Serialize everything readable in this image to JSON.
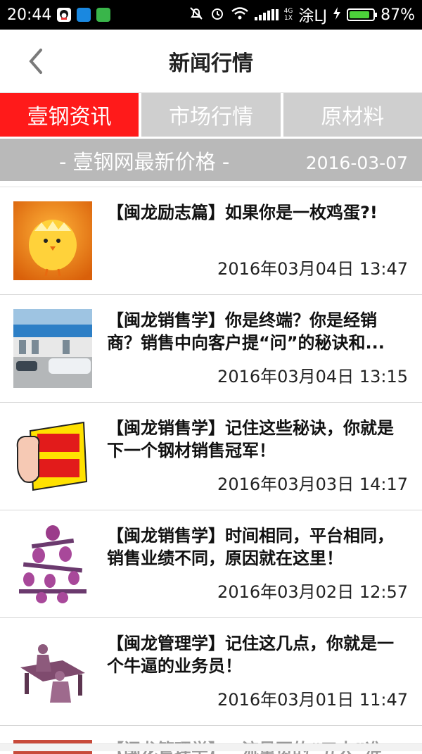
{
  "status_bar": {
    "time": "20:44",
    "network": "4G\n1X",
    "carrier": "涂LJ",
    "battery_text": "87%",
    "battery_level": 0.87
  },
  "header": {
    "title": "新闻行情"
  },
  "tabs": [
    {
      "label": "壹钢资讯",
      "active": true
    },
    {
      "label": "市场行情",
      "active": false
    },
    {
      "label": "原材料",
      "active": false
    }
  ],
  "band": {
    "slogan": "- 壹钢网最新价格 -",
    "date": "2016-03-07"
  },
  "news": [
    {
      "title": "【闽龙励志篇】如果你是一枚鸡蛋?!",
      "time": "2016年03月04日 13:47",
      "thumb": "chick-image"
    },
    {
      "title": "【闽龙销售学】你是终端？你是经销商？销售中向客户提“问”的秘诀和...",
      "time": "2016年03月04日 13:15",
      "thumb": "storefront-image"
    },
    {
      "title": "【闽龙销售学】记住这些秘诀，你就是下一个钢材销售冠军！",
      "time": "2016年03月03日 14:17",
      "thumb": "champion-thumb-image"
    },
    {
      "title": "【闽龙销售学】时间相同，平台相同，销售业绩不同，原因就在这里！",
      "time": "2016年03月02日 12:57",
      "thumb": "balance-figures-image"
    },
    {
      "title": "【闽龙管理学】记住这几点，你就是一个牛逼的业务员！",
      "time": "2016年03月01日 11:47",
      "thumb": "desk-figure-image"
    }
  ],
  "partial_item": {
    "title": "【闽龙管理学】一流量页的“五大”准"
  },
  "colors": {
    "accent": "#ff1a1a",
    "tab_inactive": "#cfcfcf",
    "band": "#b9b9b9"
  }
}
